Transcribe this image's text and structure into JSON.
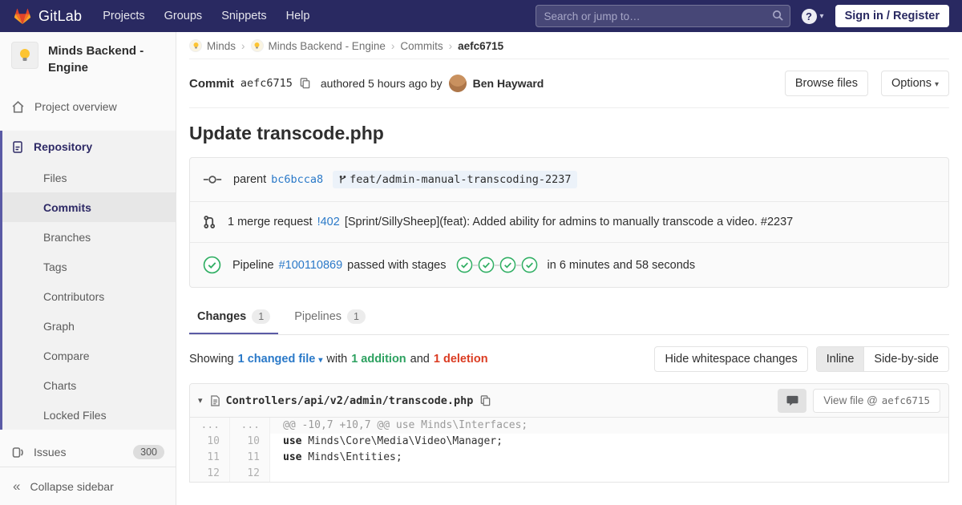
{
  "navbar": {
    "brand": "GitLab",
    "menu": [
      "Projects",
      "Groups",
      "Snippets",
      "Help"
    ],
    "search_placeholder": "Search or jump to…",
    "help_glyph": "?",
    "signin_label": "Sign in / Register"
  },
  "sidebar": {
    "project_title": "Minds Backend - Engine",
    "overview_label": "Project overview",
    "repository_label": "Repository",
    "repo_items": [
      "Files",
      "Commits",
      "Branches",
      "Tags",
      "Contributors",
      "Graph",
      "Compare",
      "Charts",
      "Locked Files"
    ],
    "active_item": "Commits",
    "issues_label": "Issues",
    "issues_count": "300",
    "collapse_label": "Collapse sidebar"
  },
  "breadcrumb": {
    "separator": "›",
    "items": [
      "Minds",
      "Minds Backend - Engine",
      "Commits",
      "aefc6715"
    ]
  },
  "commit_header": {
    "label": "Commit",
    "sha": "aefc6715",
    "authored": "authored 5 hours ago by",
    "author": "Ben Hayward",
    "browse_label": "Browse files",
    "options_label": "Options"
  },
  "commit": {
    "title": "Update transcode.php",
    "parent_label": "parent",
    "parent_sha": "bc6bcca8",
    "branch": "feat/admin-manual-transcoding-2237",
    "mr_count_text": "1 merge request",
    "mr_link": "!402",
    "mr_title": "[Sprint/SillySheep](feat): Added ability for admins to manually transcode a video. #2237",
    "pipeline_label": "Pipeline",
    "pipeline_id": "#100110869",
    "pipeline_status": "passed with stages",
    "pipeline_stage_count": 4,
    "pipeline_duration": "in 6 minutes and 58 seconds"
  },
  "tabs": {
    "changes_label": "Changes",
    "changes_count": "1",
    "pipelines_label": "Pipelines",
    "pipelines_count": "1"
  },
  "changes_bar": {
    "showing": "Showing",
    "changed_files": "1 changed file",
    "with": "with",
    "additions": "1 addition",
    "and": "and",
    "deletions": "1 deletion",
    "hide_whitespace": "Hide whitespace changes",
    "inline": "Inline",
    "side_by_side": "Side-by-side"
  },
  "diff": {
    "file_path": "Controllers/api/v2/admin/transcode.php",
    "view_file_label": "View file @",
    "view_file_sha": "aefc6715",
    "lines": [
      {
        "old": "...",
        "new": "...",
        "keyword": "",
        "code": "@@ -10,7 +10,7 @@ use Minds\\Interfaces;"
      },
      {
        "old": "10",
        "new": "10",
        "keyword": "use",
        "code": " Minds\\Core\\Media\\Video\\Manager;"
      },
      {
        "old": "11",
        "new": "11",
        "keyword": "use",
        "code": " Minds\\Entities;"
      },
      {
        "old": "12",
        "new": "12",
        "keyword": "",
        "code": ""
      }
    ]
  },
  "colors": {
    "navbar_bg": "#292961",
    "accent_indigo": "#5a5aa5",
    "link_blue": "#2a79c8",
    "addition_green": "#2da160",
    "deletion_red": "#db3b21",
    "pipeline_green": "#31af64",
    "logo_red": "#e24329",
    "logo_orange": "#fc6d26",
    "logo_yellow": "#fca326"
  }
}
